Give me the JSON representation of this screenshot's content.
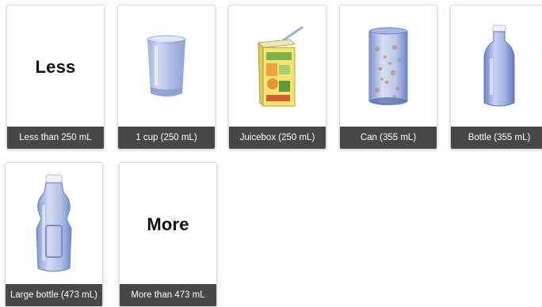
{
  "options": [
    {
      "id": "less",
      "label": "Less than 250 mL",
      "big_word": "Less",
      "icon": "less-text"
    },
    {
      "id": "cup",
      "label": "1 cup (250 mL)",
      "icon": "glass-cup-icon"
    },
    {
      "id": "juicebox",
      "label": "Juicebox (250 mL)",
      "icon": "juicebox-icon"
    },
    {
      "id": "can",
      "label": "Can (355 mL)",
      "icon": "can-icon"
    },
    {
      "id": "bottle",
      "label": "Bottle (355 mL)",
      "icon": "bottle-icon"
    },
    {
      "id": "large_bottle",
      "label": "Large bottle (473 mL)",
      "icon": "large-bottle-icon"
    },
    {
      "id": "more",
      "label": "More than 473 mL",
      "big_word": "More",
      "icon": "more-text"
    }
  ],
  "colors": {
    "caption_bg": "#474747",
    "caption_text": "#ffffff",
    "card_border": "#dcdcdc",
    "container_tint": "#8fa3d6"
  }
}
